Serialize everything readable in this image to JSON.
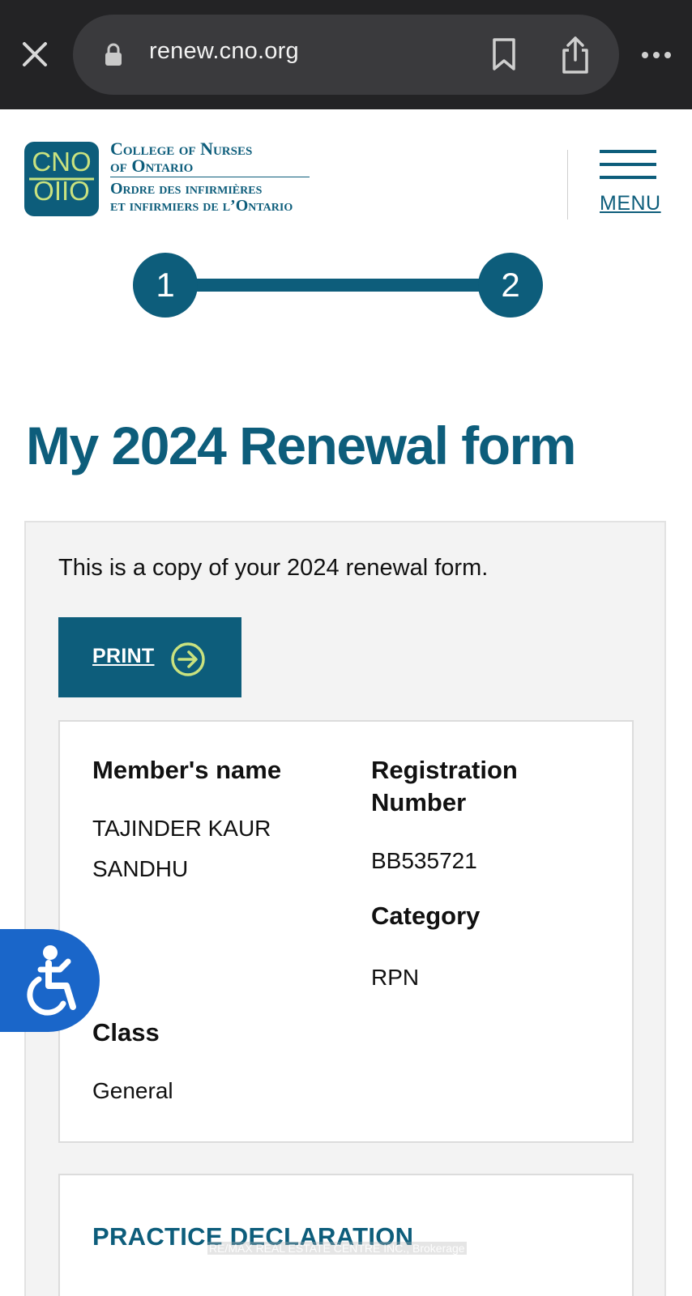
{
  "browser": {
    "url": "renew.cno.org"
  },
  "header": {
    "logo": {
      "line1": "College of Nurses",
      "line2": "of Ontario",
      "line3": "Ordre des infirmières",
      "line4": "et infirmiers de l’Ontario",
      "mark_top": "CNO",
      "mark_bottom": "OIIO"
    },
    "menu_label": "MENU"
  },
  "stepper": {
    "steps": [
      "1",
      "2"
    ]
  },
  "page_title": "My 2024 Renewal form",
  "intro_text": "This is a copy of your 2024 renewal form.",
  "print_label": "PRINT",
  "member": {
    "name_label": "Member's name",
    "name_line1": "TAJINDER KAUR",
    "name_line2": "SANDHU",
    "registration_label_line1": "Registration",
    "registration_label_line2": "Number",
    "registration_value": "BB535721",
    "category_label": "Category",
    "category_value": "RPN",
    "class_label": "Class",
    "class_value": "General"
  },
  "practice_declaration_title": "PRACTICE DECLARATION",
  "watermark": "RE/MAX REAL ESTATE CENTRE INC., Brokerage",
  "colors": {
    "brand": "#0d5d7b",
    "logo_accent": "#c9e27f",
    "print_arrow": "#c9e27f",
    "a11y_button": "#1a66c9",
    "browser_bar": "#232325"
  },
  "icons": {
    "close": "close-icon",
    "lock": "lock-icon",
    "bookmark": "bookmark-icon",
    "share": "share-icon",
    "more": "more-icon",
    "menu": "hamburger-menu-icon",
    "print": "arrow-right-circle-icon",
    "accessibility": "accessibility-icon"
  }
}
